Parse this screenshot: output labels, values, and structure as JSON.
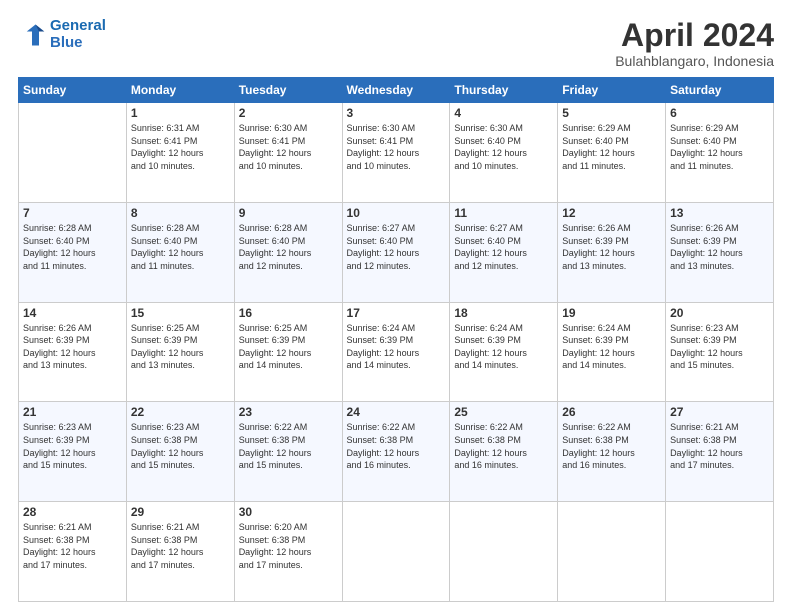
{
  "header": {
    "logo_line1": "General",
    "logo_line2": "Blue",
    "month_year": "April 2024",
    "location": "Bulahblangaro, Indonesia"
  },
  "days_of_week": [
    "Sunday",
    "Monday",
    "Tuesday",
    "Wednesday",
    "Thursday",
    "Friday",
    "Saturday"
  ],
  "weeks": [
    [
      {
        "day": "",
        "info": ""
      },
      {
        "day": "1",
        "info": "Sunrise: 6:31 AM\nSunset: 6:41 PM\nDaylight: 12 hours\nand 10 minutes."
      },
      {
        "day": "2",
        "info": "Sunrise: 6:30 AM\nSunset: 6:41 PM\nDaylight: 12 hours\nand 10 minutes."
      },
      {
        "day": "3",
        "info": "Sunrise: 6:30 AM\nSunset: 6:41 PM\nDaylight: 12 hours\nand 10 minutes."
      },
      {
        "day": "4",
        "info": "Sunrise: 6:30 AM\nSunset: 6:40 PM\nDaylight: 12 hours\nand 10 minutes."
      },
      {
        "day": "5",
        "info": "Sunrise: 6:29 AM\nSunset: 6:40 PM\nDaylight: 12 hours\nand 11 minutes."
      },
      {
        "day": "6",
        "info": "Sunrise: 6:29 AM\nSunset: 6:40 PM\nDaylight: 12 hours\nand 11 minutes."
      }
    ],
    [
      {
        "day": "7",
        "info": "Sunrise: 6:28 AM\nSunset: 6:40 PM\nDaylight: 12 hours\nand 11 minutes."
      },
      {
        "day": "8",
        "info": "Sunrise: 6:28 AM\nSunset: 6:40 PM\nDaylight: 12 hours\nand 11 minutes."
      },
      {
        "day": "9",
        "info": "Sunrise: 6:28 AM\nSunset: 6:40 PM\nDaylight: 12 hours\nand 12 minutes."
      },
      {
        "day": "10",
        "info": "Sunrise: 6:27 AM\nSunset: 6:40 PM\nDaylight: 12 hours\nand 12 minutes."
      },
      {
        "day": "11",
        "info": "Sunrise: 6:27 AM\nSunset: 6:40 PM\nDaylight: 12 hours\nand 12 minutes."
      },
      {
        "day": "12",
        "info": "Sunrise: 6:26 AM\nSunset: 6:39 PM\nDaylight: 12 hours\nand 13 minutes."
      },
      {
        "day": "13",
        "info": "Sunrise: 6:26 AM\nSunset: 6:39 PM\nDaylight: 12 hours\nand 13 minutes."
      }
    ],
    [
      {
        "day": "14",
        "info": "Sunrise: 6:26 AM\nSunset: 6:39 PM\nDaylight: 12 hours\nand 13 minutes."
      },
      {
        "day": "15",
        "info": "Sunrise: 6:25 AM\nSunset: 6:39 PM\nDaylight: 12 hours\nand 13 minutes."
      },
      {
        "day": "16",
        "info": "Sunrise: 6:25 AM\nSunset: 6:39 PM\nDaylight: 12 hours\nand 14 minutes."
      },
      {
        "day": "17",
        "info": "Sunrise: 6:24 AM\nSunset: 6:39 PM\nDaylight: 12 hours\nand 14 minutes."
      },
      {
        "day": "18",
        "info": "Sunrise: 6:24 AM\nSunset: 6:39 PM\nDaylight: 12 hours\nand 14 minutes."
      },
      {
        "day": "19",
        "info": "Sunrise: 6:24 AM\nSunset: 6:39 PM\nDaylight: 12 hours\nand 14 minutes."
      },
      {
        "day": "20",
        "info": "Sunrise: 6:23 AM\nSunset: 6:39 PM\nDaylight: 12 hours\nand 15 minutes."
      }
    ],
    [
      {
        "day": "21",
        "info": "Sunrise: 6:23 AM\nSunset: 6:39 PM\nDaylight: 12 hours\nand 15 minutes."
      },
      {
        "day": "22",
        "info": "Sunrise: 6:23 AM\nSunset: 6:38 PM\nDaylight: 12 hours\nand 15 minutes."
      },
      {
        "day": "23",
        "info": "Sunrise: 6:22 AM\nSunset: 6:38 PM\nDaylight: 12 hours\nand 15 minutes."
      },
      {
        "day": "24",
        "info": "Sunrise: 6:22 AM\nSunset: 6:38 PM\nDaylight: 12 hours\nand 16 minutes."
      },
      {
        "day": "25",
        "info": "Sunrise: 6:22 AM\nSunset: 6:38 PM\nDaylight: 12 hours\nand 16 minutes."
      },
      {
        "day": "26",
        "info": "Sunrise: 6:22 AM\nSunset: 6:38 PM\nDaylight: 12 hours\nand 16 minutes."
      },
      {
        "day": "27",
        "info": "Sunrise: 6:21 AM\nSunset: 6:38 PM\nDaylight: 12 hours\nand 17 minutes."
      }
    ],
    [
      {
        "day": "28",
        "info": "Sunrise: 6:21 AM\nSunset: 6:38 PM\nDaylight: 12 hours\nand 17 minutes."
      },
      {
        "day": "29",
        "info": "Sunrise: 6:21 AM\nSunset: 6:38 PM\nDaylight: 12 hours\nand 17 minutes."
      },
      {
        "day": "30",
        "info": "Sunrise: 6:20 AM\nSunset: 6:38 PM\nDaylight: 12 hours\nand 17 minutes."
      },
      {
        "day": "",
        "info": ""
      },
      {
        "day": "",
        "info": ""
      },
      {
        "day": "",
        "info": ""
      },
      {
        "day": "",
        "info": ""
      }
    ]
  ]
}
